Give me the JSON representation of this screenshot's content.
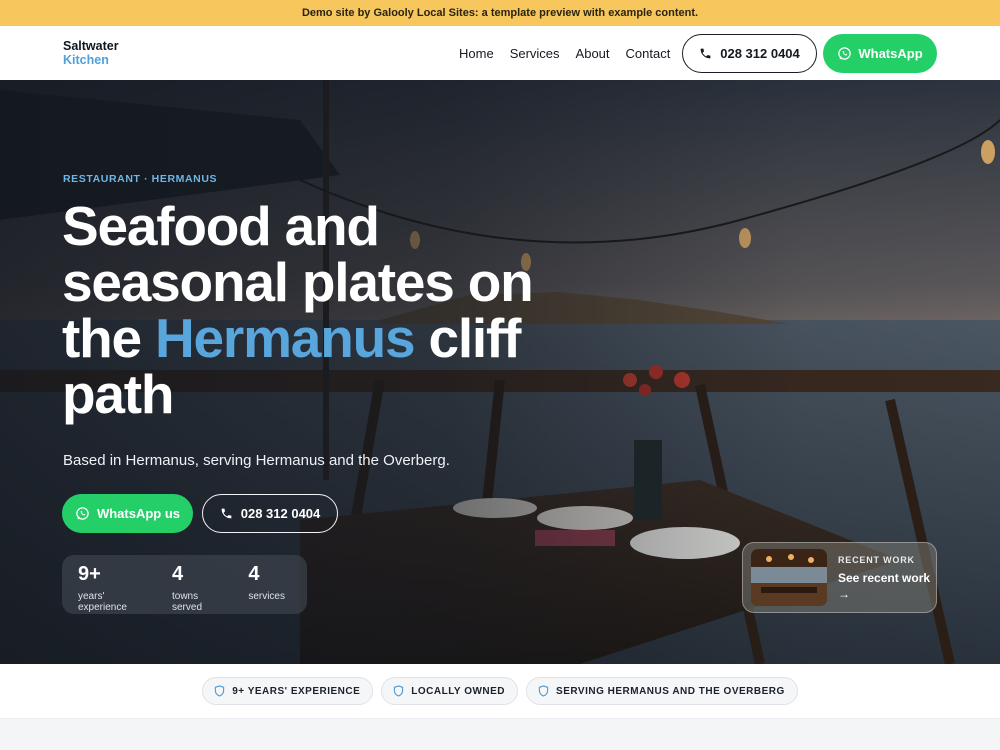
{
  "banner": {
    "text": "Demo site by Galooly Local Sites: a template preview with example content."
  },
  "brand": {
    "line1": "Saltwater",
    "line2": "Kitchen"
  },
  "nav": {
    "links": [
      "Home",
      "Services",
      "About",
      "Contact"
    ],
    "phone_label": "028 312 0404",
    "whatsapp_label": "WhatsApp"
  },
  "hero": {
    "eyebrow": "RESTAURANT · HERMANUS",
    "headline_pre": "Seafood and seasonal plates on the ",
    "headline_highlight": "Hermanus",
    "headline_post": " cliff path",
    "subtitle": "Based in Hermanus, serving Hermanus and the Overberg.",
    "cta_whatsapp": "WhatsApp us",
    "cta_phone": "028 312 0404",
    "stats": [
      {
        "value": "9+",
        "label": "years' experience"
      },
      {
        "value": "4",
        "label": "towns served"
      },
      {
        "value": "4",
        "label": "services"
      }
    ],
    "recent": {
      "tag": "RECENT WORK",
      "link": "See recent work",
      "arrow": "→"
    }
  },
  "trust": {
    "chips": [
      "9+ YEARS' EXPERIENCE",
      "LOCALLY OWNED",
      "SERVING HERMANUS AND THE OVERBERG"
    ]
  },
  "colors": {
    "banner": "#f7c65c",
    "accent_blue": "#58a6dc",
    "whatsapp_green": "#25cf68"
  },
  "icons": {
    "phone": "phone-icon",
    "whatsapp": "whatsapp-icon",
    "shield": "shield-icon",
    "arrow": "arrow-right-icon"
  }
}
